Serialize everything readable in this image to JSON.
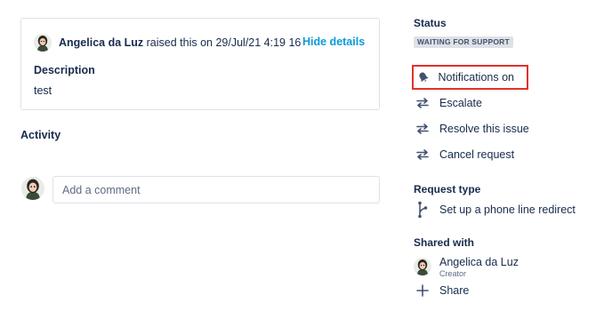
{
  "request": {
    "reporter_name": "Angelica da Luz",
    "raised_text": "raised this on 29/Jul/21 4:19 16",
    "hide_details_label": "Hide details",
    "description_label": "Description",
    "description_value": "test"
  },
  "activity": {
    "title": "Activity",
    "comment_placeholder": "Add a comment"
  },
  "sidebar": {
    "status_title": "Status",
    "status_value": "WAITING FOR SUPPORT",
    "actions": [
      {
        "label": "Notifications on",
        "icon": "bell-icon"
      },
      {
        "label": "Escalate",
        "icon": "transition-arrows-icon"
      },
      {
        "label": "Resolve this issue",
        "icon": "transition-arrows-icon"
      },
      {
        "label": "Cancel request",
        "icon": "transition-arrows-icon"
      }
    ],
    "request_type_title": "Request type",
    "request_type_value": "Set up a phone line redirect",
    "shared_with_title": "Shared with",
    "shared_user_name": "Angelica da Luz",
    "shared_user_role": "Creator",
    "share_label": "Share"
  },
  "colors": {
    "link": "#0a9bd8",
    "text": "#172b4d",
    "highlight_border": "#e0322c",
    "badge_bg": "#dfe1e6"
  }
}
